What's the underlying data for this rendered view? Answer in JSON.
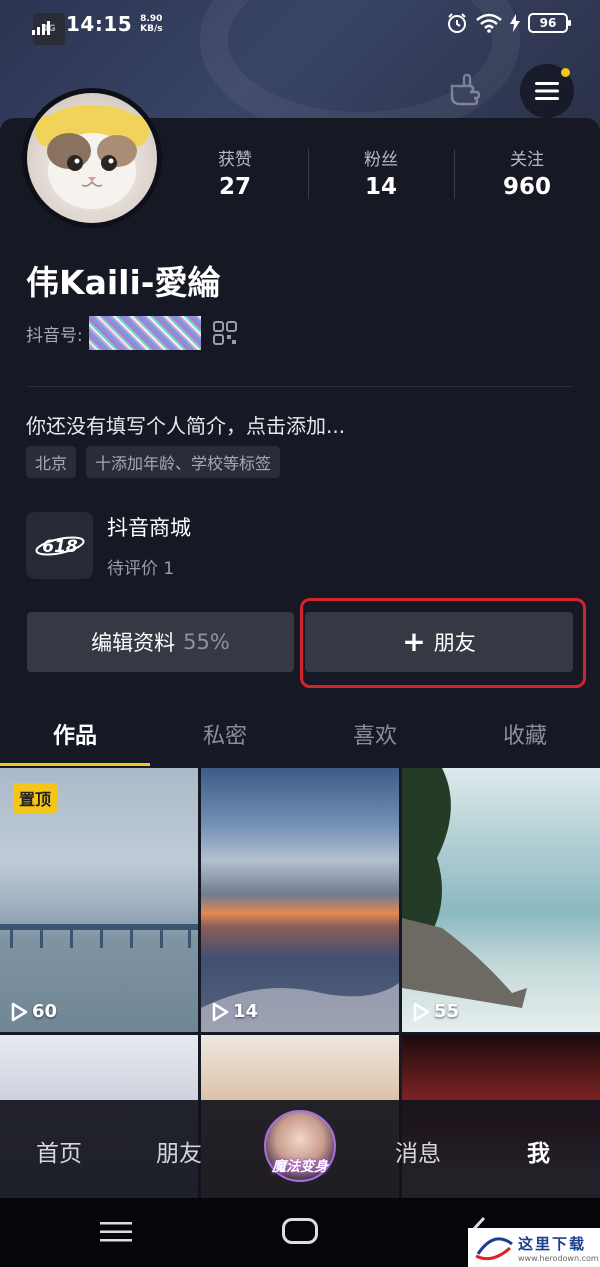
{
  "status_bar": {
    "network": "4G",
    "time": "14:15",
    "net_speed_value": "8.90",
    "net_speed_unit": "KB/s",
    "battery": "96"
  },
  "profile": {
    "username": "伟Kaili-愛綸",
    "douyin_id_label": "抖音号:",
    "stats": [
      {
        "label": "获赞",
        "value": "27"
      },
      {
        "label": "粉丝",
        "value": "14"
      },
      {
        "label": "关注",
        "value": "960"
      }
    ],
    "bio": "你还没有填写个人简介，点击添加...",
    "tags": [
      "北京",
      "十添加年龄、学校等标签"
    ]
  },
  "shop": {
    "logo_text": "618",
    "title": "抖音商城",
    "subtitle": "待评价 1"
  },
  "actions": {
    "edit_label": "编辑资料",
    "edit_percent": "55%",
    "add_friend_plus": "+",
    "add_friend_label": "朋友"
  },
  "tabs": [
    {
      "label": "作品",
      "active": true
    },
    {
      "label": "私密",
      "active": false
    },
    {
      "label": "喜欢",
      "active": false
    },
    {
      "label": "收藏",
      "active": false
    }
  ],
  "videos": [
    {
      "plays": "60",
      "pinned_label": "置顶"
    },
    {
      "plays": "14"
    },
    {
      "plays": "55"
    }
  ],
  "bottom_nav": {
    "home": "首页",
    "friends": "朋友",
    "magic_label": "魔法变身",
    "messages": "消息",
    "me": "我"
  },
  "watermark": {
    "text": "这里下载",
    "url": "www.herodown.com"
  },
  "colors": {
    "background": "#161824",
    "accent_yellow": "#f5c518",
    "highlight_red": "#d3232e",
    "button_bg": "#363844"
  }
}
